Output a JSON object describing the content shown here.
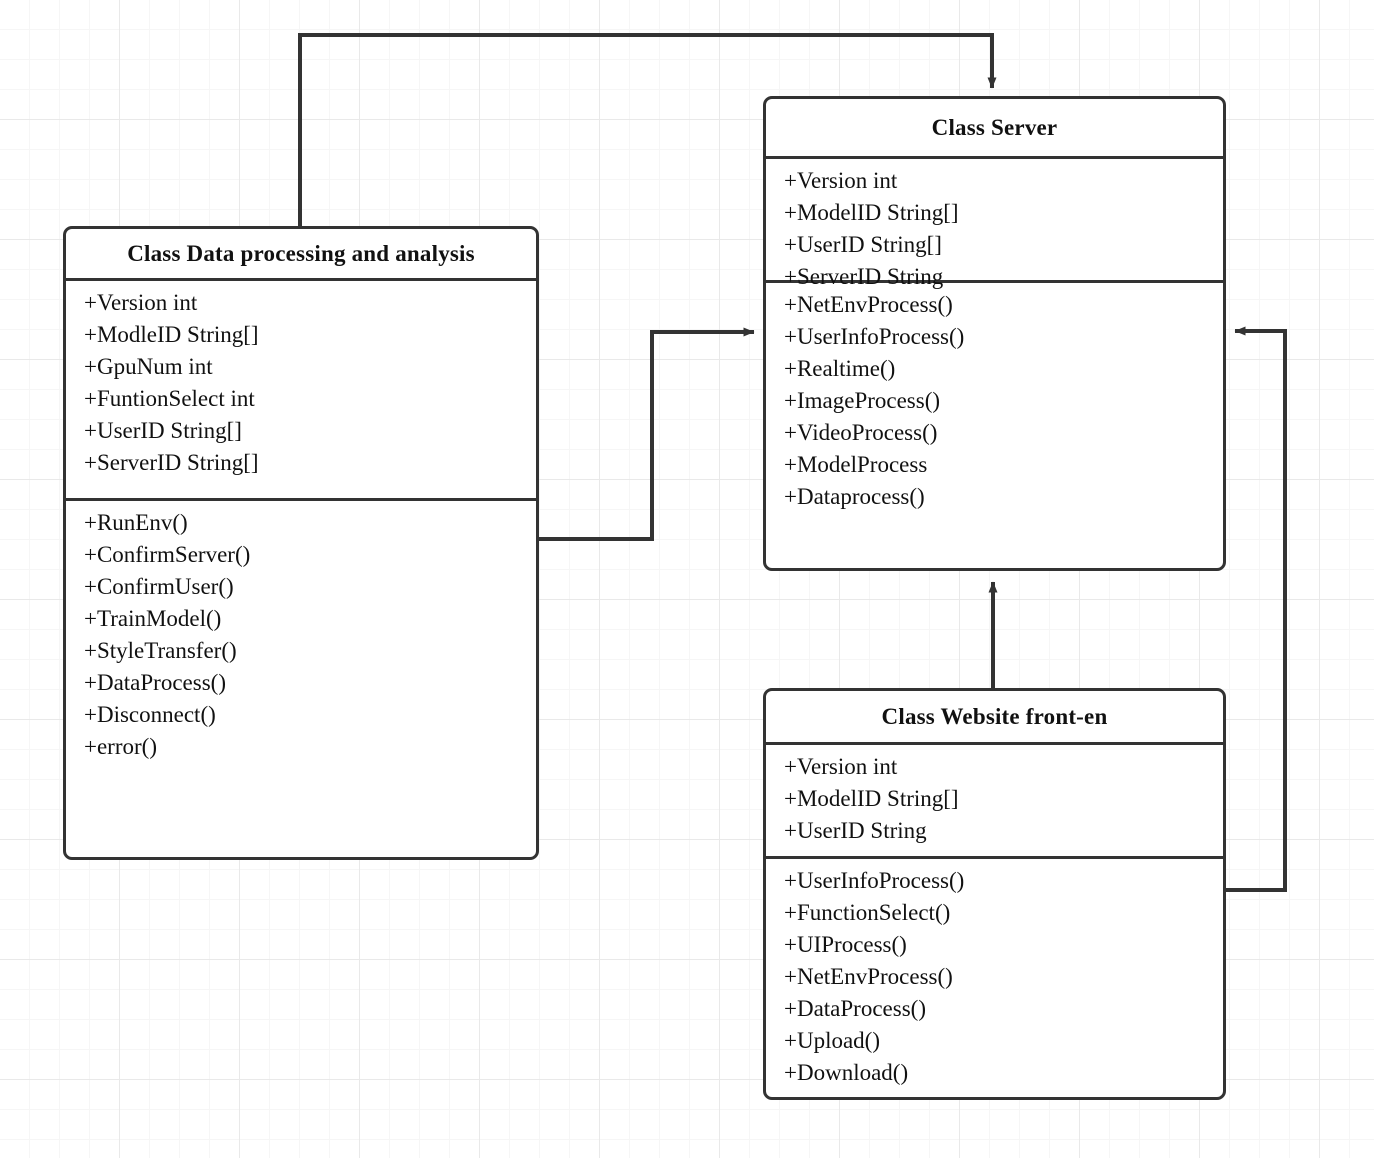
{
  "diagram": {
    "title": "UML class diagram",
    "background": "graph-paper-grid",
    "line_color": "#333333",
    "box_fill": "#ffffff"
  },
  "classes": [
    {
      "id": "data-processing",
      "title": "Class Data processing and analysis",
      "attributes": [
        "+Version int",
        "+ModleID String[]",
        "+GpuNum int",
        "+FuntionSelect int",
        "+UserID String[]",
        "+ServerID String[]"
      ],
      "methods": [
        "+RunEnv()",
        "+ConfirmServer()",
        "+ConfirmUser()",
        "+TrainModel()",
        "+StyleTransfer()",
        "+DataProcess()",
        "+Disconnect()",
        "+error()"
      ]
    },
    {
      "id": "server",
      "title": "Class Server",
      "attributes": [
        "+Version int",
        "+ModelID String[]",
        "+UserID String[]",
        "+ServerID String"
      ],
      "methods": [
        "+NetEnvProcess()",
        "+UserInfoProcess()",
        "+Realtime()",
        "+ImageProcess()",
        "+VideoProcess()",
        "+ModelProcess",
        "+Dataprocess()"
      ]
    },
    {
      "id": "website",
      "title": "Class Website front-en",
      "attributes": [
        "+Version int",
        "+ModelID String[]",
        "+UserID String"
      ],
      "methods": [
        "+UserInfoProcess()",
        "+FunctionSelect()",
        "+UIProcess()",
        "+NetEnvProcess()",
        "+DataProcess()",
        "+Upload()",
        "+Download()"
      ]
    }
  ],
  "connectors": [
    {
      "id": "data-to-server-top",
      "from": "data-processing",
      "to": "server",
      "arrow_at": "server-top"
    },
    {
      "id": "data-to-server-middle",
      "from": "data-processing",
      "to": "server",
      "arrow_at": "server-left"
    },
    {
      "id": "website-to-server-bottom",
      "from": "website",
      "to": "server",
      "arrow_at": "server-bottom"
    },
    {
      "id": "website-to-server-right",
      "from": "website",
      "to": "server",
      "arrow_at": "server-right"
    }
  ]
}
